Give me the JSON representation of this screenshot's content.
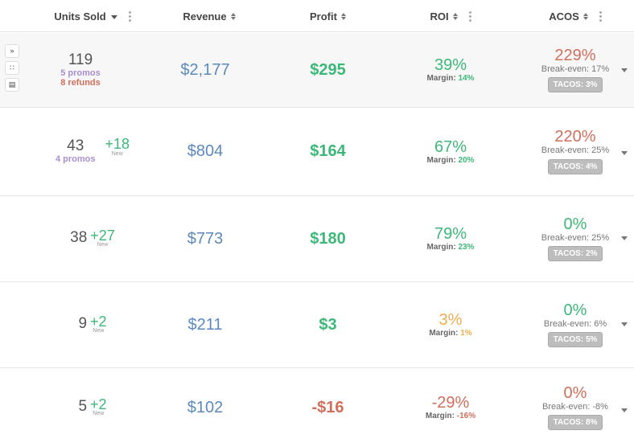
{
  "colors": {
    "green": "#3cb878",
    "red": "#d16e5c",
    "orange": "#f0ad4e",
    "blue": "#5a8ac0",
    "purple": "#a98fd0"
  },
  "header": {
    "units_sold": "Units Sold",
    "revenue": "Revenue",
    "profit": "Profit",
    "roi": "ROI",
    "acos": "ACOS"
  },
  "rows": [
    {
      "units": "119",
      "promos": "5 promos",
      "refunds": "8 refunds",
      "delta": "",
      "delta_label": "",
      "revenue": "$2,177",
      "profit": "$295",
      "profit_color": "#3cb878",
      "roi": "39%",
      "roi_color": "#3cb878",
      "margin_label": "Margin:",
      "margin": "14%",
      "acos": "229%",
      "acos_color": "#d16e5c",
      "break_even": "Break-even: 17%",
      "tacos": "TACOS: 3%"
    },
    {
      "units": "43",
      "promos": "4 promos",
      "refunds": "",
      "delta": "+18",
      "delta_label": "New",
      "revenue": "$804",
      "profit": "$164",
      "profit_color": "#3cb878",
      "roi": "67%",
      "roi_color": "#3cb878",
      "margin_label": "Margin:",
      "margin": "20%",
      "acos": "220%",
      "acos_color": "#d16e5c",
      "break_even": "Break-even: 25%",
      "tacos": "TACOS: 4%"
    },
    {
      "units": "38",
      "promos": "",
      "refunds": "",
      "delta": "+27",
      "delta_label": "New",
      "revenue": "$773",
      "profit": "$180",
      "profit_color": "#3cb878",
      "roi": "79%",
      "roi_color": "#3cb878",
      "margin_label": "Margin:",
      "margin": "23%",
      "acos": "0%",
      "acos_color": "#3cb878",
      "break_even": "Break-even: 25%",
      "tacos": "TACOS: 2%"
    },
    {
      "units": "9",
      "promos": "",
      "refunds": "",
      "delta": "+2",
      "delta_label": "New",
      "revenue": "$211",
      "profit": "$3",
      "profit_color": "#3cb878",
      "roi": "3%",
      "roi_color": "#f0ad4e",
      "margin_label": "Margin:",
      "margin": "1%",
      "acos": "0%",
      "acos_color": "#3cb878",
      "break_even": "Break-even: 6%",
      "tacos": "TACOS: 5%"
    },
    {
      "units": "5",
      "promos": "",
      "refunds": "",
      "delta": "+2",
      "delta_label": "New",
      "revenue": "$102",
      "profit": "-$16",
      "profit_color": "#d16e5c",
      "roi": "-29%",
      "roi_color": "#d16e5c",
      "margin_label": "Margin:",
      "margin": "-16%",
      "acos": "0%",
      "acos_color": "#d16e5c",
      "break_even": "Break-even: -8%",
      "tacos": "TACOS: 8%"
    }
  ]
}
